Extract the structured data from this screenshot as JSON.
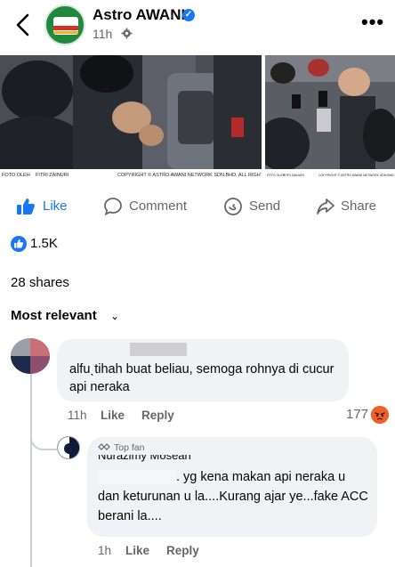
{
  "header": {
    "page_name": "Astro AWANI",
    "time": "11h"
  },
  "post": {
    "photo_left_credits": [
      "FOTO OLEH",
      "FITRI ZAINURI",
      "COPYRIGHT © ASTRO AWANI NETWORK SDN.BHD. ALL RIGHT"
    ],
    "photo_right_credits": [
      "FOTO OLEH",
      "FITRI ZAINURI",
      "COPYRIGHT © ASTRO AWANI NETWORK SDN.BHD. ALL RIGHTS"
    ],
    "actions": {
      "like": "Like",
      "comment": "Comment",
      "send": "Send",
      "share": "Share"
    },
    "reactions": "1.5K",
    "shares": "28 shares"
  },
  "comments": {
    "sort_label": "Most relevant",
    "items": [
      {
        "text": "alfuˎtihah buat beliau, semoga rohnya di cucur api neraka",
        "time": "11h",
        "like": "Like",
        "reply": "Reply",
        "reaction_count": "177"
      }
    ],
    "reply": {
      "badge": "Top fan",
      "author": "Nurazimy Mosean",
      "text": ". yg kena makan api neraka u dan keturunan u la....Kurang ajar ye...fake ACC berani la....",
      "time": "1h",
      "like": "Like",
      "reply": "Reply"
    }
  },
  "colors": {
    "accent": "#1877f2",
    "secondary_text": "#65676b",
    "bubble": "#f0f2f5",
    "angry": "#e9710f"
  },
  "icons": [
    "back-arrow-icon",
    "verified-icon",
    "globe-gear-icon",
    "more-icon",
    "like-thumb-icon",
    "comment-icon",
    "send-icon",
    "share-icon",
    "like-badge-icon",
    "chevron-down-icon",
    "angry-reaction-icon",
    "top-fan-icon"
  ]
}
